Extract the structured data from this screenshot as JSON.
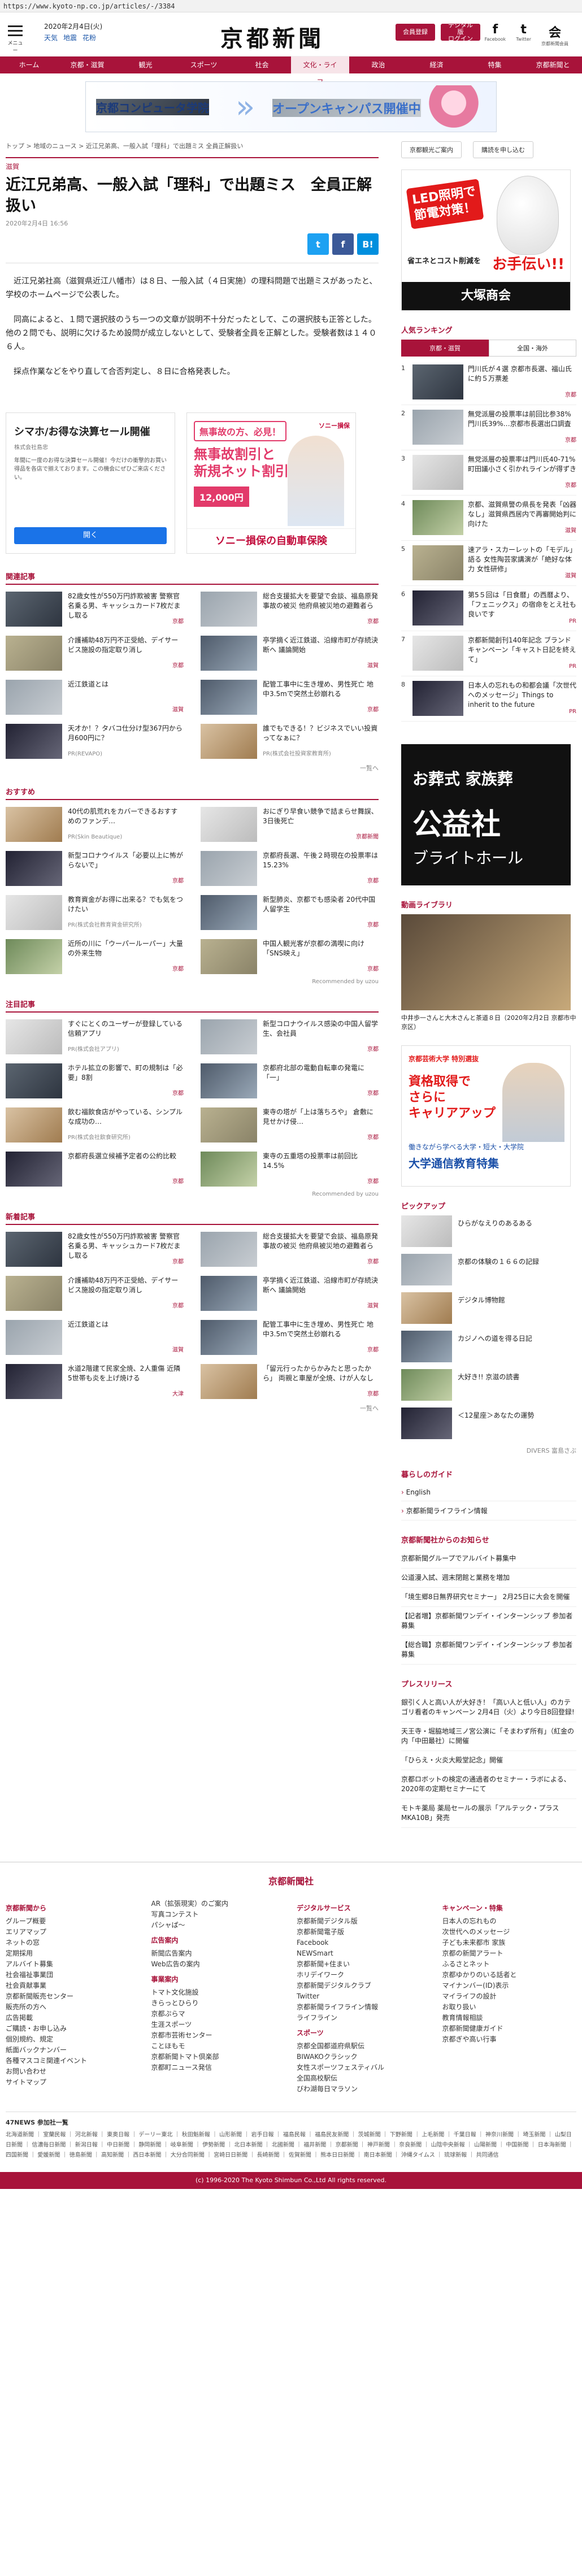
{
  "browser": {
    "url": "https://www.kyoto-np.co.jp/articles/-/3384"
  },
  "header": {
    "menu_label": "メニュー",
    "date": "2020年2月4日(火)",
    "weather": [
      "天気",
      "地震",
      "花粉"
    ],
    "logo": "京都新聞",
    "btn_login": "会員登録",
    "btn_digital": "デジタル版\nログイン",
    "social": [
      {
        "icon": "f",
        "label": "Facebook"
      },
      {
        "icon": "t",
        "label": "Twitter"
      },
      {
        "icon": "会",
        "label": "京都新聞会員"
      }
    ]
  },
  "nav": [
    "ホーム",
    "京都・滋賀",
    "観光",
    "スポーツ",
    "社会",
    "文化・ライフ",
    "政治",
    "経済",
    "特集",
    "京都新聞とは"
  ],
  "nav_active": 5,
  "banner": {
    "school": "京都コンピュータ学院",
    "event": "オープンキャンパス開催中"
  },
  "breadcrumb": "トップ > 地域のニュース > 近江兄弟高、一般入試「理科」で出題ミス 全員正解扱い",
  "side_links": [
    "京都観光ご案内",
    "購読を申し込む"
  ],
  "article": {
    "category": "滋賀",
    "title": "近江兄弟高、一般入試「理科」で出題ミス　全員正解扱い",
    "date": "2020年2月4日 16:56",
    "paragraphs": [
      "近江兄弟社高（滋賀県近江八幡市）は８日、一般入試（４日実施）の理科問題で出題ミスがあったと、学校のホームページで公表した。",
      "同高によると、１問で選択肢のうち一つの文章が説明不十分だったとして、この選択肢も正答とした。他の２問でも、説明に欠けるため設問が成立しないとして、受験者全員を正解とした。受験者数は１４０６人。",
      "採点作業などをやり直して合否判定し、８日に合格発表した。"
    ]
  },
  "share": {
    "tw": "t",
    "fb": "f",
    "hb": "B!"
  },
  "ads": {
    "left": {
      "title": "シマホ/お得な決算セール開催",
      "sponsor": "株式会社島忠",
      "desc": "年間に一度のお得な決算セール開催！今だけの衝撃的お買い得品を各店で揃えております。この機会にぜひご来店ください。",
      "btn": "開く"
    },
    "right": {
      "badge": "無事故の方、必見！",
      "main": "無事故割引と\n新規ネット割引",
      "price": "12,000円",
      "brand": "ソニー損保",
      "foot": "ソニー損保の自動車保険"
    }
  },
  "sections": [
    {
      "title": "関連記事",
      "cards": [
        {
          "text": "82歳女性が550万円詐欺被害 警察官名乗る男、キャッシュカード7枚だまし取る",
          "tag": "京都",
          "thumb": "t1"
        },
        {
          "text": "総合支援拡大を要望で会談、福島原発事故の被災 他府県被災地の避難者ら",
          "tag": "京都",
          "thumb": "t2"
        },
        {
          "text": "介護補助48万円不正受給、デイサービス施設の指定取り消し",
          "tag": "京都",
          "thumb": "t3"
        },
        {
          "text": "亭学摘く近江鉄道、沿線市町が存続決断へ 議論開始",
          "tag": "滋賀",
          "thumb": "t4"
        },
        {
          "text": "近江鉄道とは",
          "tag": "滋賀",
          "thumb": "t2"
        },
        {
          "text": "配管工事中に生き埋め、男性死亡 地中3.5mで突然土砂崩れる",
          "tag": "京都",
          "thumb": "t4"
        },
        {
          "text": "天才か！？タバコ仕分け型367円から月600円に？",
          "pr": "PR(REVAPO)",
          "thumb": "t5"
        },
        {
          "text": "誰でもできる！？ビジネスでいい投資ってなぁに？",
          "pr": "PR(株式会社投資家教育所)",
          "thumb": "t6"
        }
      ]
    }
  ],
  "osusume": {
    "title": "おすすめ",
    "cards": [
      {
        "text": "40代の肌荒れをカバーできるおすすめのファンデ…",
        "pr": "PR(Skin Beautique)",
        "thumb": "t6"
      },
      {
        "text": "おにぎり早食い競争で詰まらせ舞誤、3日後死亡",
        "tag": "京都新聞",
        "thumb": "t7"
      },
      {
        "text": "新型コロナウイルス「必要以上に怖がらないで」",
        "tag": "京都",
        "thumb": "t5"
      },
      {
        "text": "京都府長選、午後２時現在の投票率は15.23%",
        "tag": "京都",
        "thumb": "t2"
      },
      {
        "text": "教育資金がお得に出来る？でも気をつけたい",
        "pr": "PR(株式会社教育資金研究所)",
        "thumb": "t7"
      },
      {
        "text": "新型肺炎、京都でも感染者 20代中国人留学生",
        "tag": "京都",
        "thumb": "t4"
      },
      {
        "text": "近所の川に「ウーパールーパー」大量の外来生物",
        "tag": "京都",
        "thumb": "t8"
      },
      {
        "text": "中国人観光客が京都の満喫に向け 「SNS映え」",
        "tag": "京都",
        "thumb": "t3"
      }
    ]
  },
  "chumoku": {
    "title": "注目記事",
    "cards": [
      {
        "text": "すぐにとくのユーザーが登録している信頼アプリ",
        "pr": "PR(株式会社アプリ)",
        "thumb": "t7"
      },
      {
        "text": "新型コロナウイルス感染の中国人留学生、会社員",
        "tag": "京都",
        "thumb": "t2"
      },
      {
        "text": "ホテル拡立の影響で、町の規制は「必要」8割",
        "tag": "京都",
        "thumb": "t1"
      },
      {
        "text": "京都府北部の電動自転車の発電に「一」",
        "tag": "京都",
        "thumb": "t4"
      },
      {
        "text": "飲む福飲食店がやっている、シンプルな成功の…",
        "pr": "PR(株式会社飲食研究所)",
        "thumb": "t6"
      },
      {
        "text": "東寺の塔が「上は落ちろや」 倉敷に見せかけ侵…",
        "tag": "京都",
        "thumb": "t3"
      },
      {
        "text": "京都府長選立候補予定者の公約比較",
        "tag": "京都",
        "thumb": "t5"
      },
      {
        "text": "東寺の五重塔の投票率は前回比14.5%",
        "tag": "京都",
        "thumb": "t8"
      }
    ]
  },
  "shinchaku": {
    "title": "新着記事",
    "cards": [
      {
        "text": "82歳女性が550万円詐欺被害 警察官名乗る男、キャッシュカード7枚だまし取る",
        "tag": "京都",
        "thumb": "t1"
      },
      {
        "text": "総合支援拡大を要望で会談、福島原発事故の被災 他府県被災地の避難者ら",
        "tag": "京都",
        "thumb": "t2"
      },
      {
        "text": "介護補助48万円不正受給、デイサービス施設の指定取り消し",
        "tag": "京都",
        "thumb": "t3"
      },
      {
        "text": "亭学摘く近江鉄道、沿線市町が存続決断へ 議論開始",
        "tag": "滋賀",
        "thumb": "t4"
      },
      {
        "text": "近江鉄道とは",
        "tag": "滋賀",
        "thumb": "t2"
      },
      {
        "text": "配管工事中に生き埋め、男性死亡 地中3.5mで突然土砂崩れる",
        "tag": "京都",
        "thumb": "t4"
      },
      {
        "text": "水道2階建て民家全焼、2人重傷 近隣5世帯も炎を上げ焼ける",
        "tag": "大津",
        "thumb": "t5"
      },
      {
        "text": "「留元行ったからかみたと思ったから」 両親と車屋が全焼、けが人なし",
        "tag": "京都",
        "thumb": "t6"
      }
    ]
  },
  "more": "一覧へ",
  "recommended": "Recommended by uzou",
  "sidebar": {
    "ad1": {
      "l1": "LED照明で\n節電対策！",
      "l2": "省エネとコスト削減を",
      "l3": "お手伝い!!",
      "l4": "大塚商会"
    },
    "ranking_title": "人気ランキング",
    "rank_tabs": [
      "京都・滋賀",
      "全国・海外"
    ],
    "ranking": [
      {
        "n": "1",
        "text": "門川氏が４選 京都市長選、福山氏に約５万票差",
        "tag": "京都",
        "thumb": "t1"
      },
      {
        "n": "2",
        "text": "無党派層の投票率は前回比参38% 門川氏39%…京都市長選出口調査",
        "tag": "京都",
        "thumb": "t2"
      },
      {
        "n": "3",
        "text": "無党派層の投票率は門川氏40-71% 町田議小さく引かれラインが得ずき",
        "tag": "京都",
        "thumb": "t7"
      },
      {
        "n": "4",
        "text": "京都、滋賀県警の県長を発表「凶器なし」滋賀県西居内で再審開始判に向けた",
        "tag": "滋賀",
        "thumb": "t8"
      },
      {
        "n": "5",
        "text": "速アラ・スカーレットの「モデル」語る 女性陶芸家講演が「絶好な体力 女性研修」",
        "tag": "滋賀",
        "thumb": "t3"
      },
      {
        "n": "6",
        "text": "第5５回は「日食暦」の西暦より、「フェニックス」の宿命をとえ社も良いです",
        "tag": "PR",
        "thumb": "t5"
      },
      {
        "n": "7",
        "text": "京都新聞創刊140年記念 ブランドキャンペーン「キャスト日記を終えて」",
        "tag": "PR",
        "thumb": "t7"
      },
      {
        "n": "8",
        "text": "日本人の忘れもの和都会議「次世代へのメッセージ」Things to inherit to the future",
        "tag": "PR",
        "thumb": "t5"
      }
    ],
    "ad2": {
      "a": "お葬式 家族葬",
      "b": "公益社",
      "c": "ブライトホール"
    },
    "video_title": "動画ライブラリ",
    "video_caption": "中井歩一さんと大木さんと茶道８日（2020年2月2日 京都市中京区）",
    "ad3": {
      "x1": "京都芸術大学 特別選抜",
      "x2": "資格取得で\nさらに\nキャリアアップ",
      "x3": "働きながら学べる大学・短大・大学院",
      "x4": "大学通信教育特集"
    },
    "pickup_title": "ピックアップ",
    "pickup": [
      {
        "text": "ひらがなえりのあるある",
        "thumb": "t7"
      },
      {
        "text": "京都の体験の１６６の記録",
        "thumb": "t2"
      },
      {
        "text": "デジタル博物館",
        "thumb": "t6"
      },
      {
        "text": "カジノへの道を得る日記",
        "thumb": "t4"
      },
      {
        "text": "大好き!! 京滋の読書",
        "thumb": "t8"
      },
      {
        "text": "＜12星座＞あなたの運勢",
        "thumb": "t5"
      }
    ],
    "pickup_more": "DIVERS 富島さぶ",
    "guide_title": "暮らしのガイド",
    "guide": [
      "English",
      "京都新聞ライフライン情報"
    ],
    "fromnews_title": "京都新聞社からのお知らせ",
    "fromnews": [
      "京都新聞グループでアルバイト募集中",
      "公道漫入試、週末閉館と業務を増加",
      "「境生郷8日無界研究セミナー」 2月25日に大会を開催",
      "【記者増】京都新聞ワンデイ・インターンシップ 参加者募集",
      "【総合職】京都新聞ワンデイ・インターンシップ 参加者募集"
    ],
    "press_title": "プレスリリース",
    "press": [
      "銀引く人と高い人が大好き！「高い人と低い人」のカテゴリ看者のキャンペーン 2月4日（火）より今日8回登録!",
      "天王寺・堀脇地域三ノ宮公演に「そまわず所有」（紅金の内「中田最社）に開催",
      "「ひらえ・火炎大殿堂記念」開催",
      "京都ロボットの検定の通過者のセミナー・ラボによる、2020年の定期セミナーにて",
      "モトキ薬局 薬局セールの展示「アルテック・プラスMKA10B」発売"
    ]
  },
  "footer": {
    "logo": "京都新聞社",
    "cols": [
      {
        "h": "京都新聞から",
        "items": [
          "グループ概要",
          "エリアマップ",
          "ネットの窓",
          "定期採用",
          "アルバイト募集",
          "社会福祉事業団",
          "社会貢献事業",
          "京都新聞販売センター",
          "販売所の方へ",
          "広告掲載",
          "ご購読・お申し込み",
          "個別規約、規定",
          "紙面バックナンバー",
          "各種マスコミ関連イベント",
          "お問い合わせ",
          "サイトマップ"
        ]
      },
      {
        "h": "",
        "items": [
          "AR（拡張現実）のご案内",
          "写真コンテスト",
          "パシャぱ〜"
        ],
        "h2": "広告案内",
        "items2": [
          "新聞広告案内",
          "Web広告の案内"
        ],
        "h3": "事業案内",
        "items3": [
          "トマト文化施設",
          "きらっとひらり",
          "京都ぷらマ",
          "生涯スポーツ",
          "京都市芸術センター",
          "ことほもモ",
          "京都新聞トマト倶楽部",
          "京都町ニュース発信"
        ]
      },
      {
        "h": "デジタルサービス",
        "items": [
          "京都新聞デジタル版",
          "京都新聞電子版",
          "Facebook",
          "NEWSmart",
          "京都新聞+住まい",
          "ホリデイワーク",
          "京都新聞デジタルクラブ",
          "Twitter",
          "京都新聞ライフライン情報",
          "ライフライン"
        ],
        "h2": "スポーツ",
        "items2": [
          "京都全国都道府県駅伝",
          "BIWAKOクラシック",
          "女性スポーツフェスティバル",
          "全国高校駅伝",
          "びわ湖毎日マラソン"
        ]
      },
      {
        "h": "キャンペーン・特集",
        "items": [
          "日本人の忘れもの",
          "次世代へのメッセージ",
          "子ども未来都市 家族",
          "京都の新聞アラート",
          "ふるさとネット",
          "京都ゆかりのいる話者と",
          "マイナンバー(ID)表示",
          "マイライフの設計",
          "お取り扱い",
          "教育情報相談",
          "京都新聞健康ガイド",
          "京都ぎや高い行事"
        ]
      }
    ],
    "partner_head": "47NEWS 参加社一覧",
    "partners": "北海道新聞 ｜ 室蘭民報 ｜ 河北新報 ｜ 東奥日報 ｜ デーリー東北 ｜ 秋田魁新報 ｜ 山形新聞 ｜ 岩手日報 ｜ 福島民報 ｜ 福島民友新聞 ｜ 茨城新聞 ｜ 下野新聞 ｜ 上毛新聞 ｜ 千葉日報 ｜ 神奈川新聞 ｜ 埼玉新聞 ｜ 山梨日日新聞 ｜ 信濃毎日新聞 ｜ 新潟日報 ｜ 中日新聞 ｜ 静岡新聞 ｜ 岐阜新聞 ｜ 伊勢新聞 ｜ 北日本新聞 ｜ 北國新聞 ｜ 福井新聞 ｜ 京都新聞 ｜ 神戸新聞 ｜ 奈良新聞 ｜ 山陰中央新報 ｜ 山陽新聞 ｜ 中国新聞 ｜ 日本海新聞 ｜ 四国新聞 ｜ 愛媛新聞 ｜ 徳島新聞 ｜ 高知新聞 ｜ 西日本新聞 ｜ 大分合同新聞 ｜ 宮崎日日新聞 ｜ 長崎新聞 ｜ 佐賀新聞 ｜ 熊本日日新聞 ｜ 南日本新聞 ｜ 沖縄タイムス ｜ 琉球新報 ｜ 共同通信",
    "copyright": "(c) 1996-2020 The Kyoto Shimbun Co.,Ltd All rights reserved."
  }
}
